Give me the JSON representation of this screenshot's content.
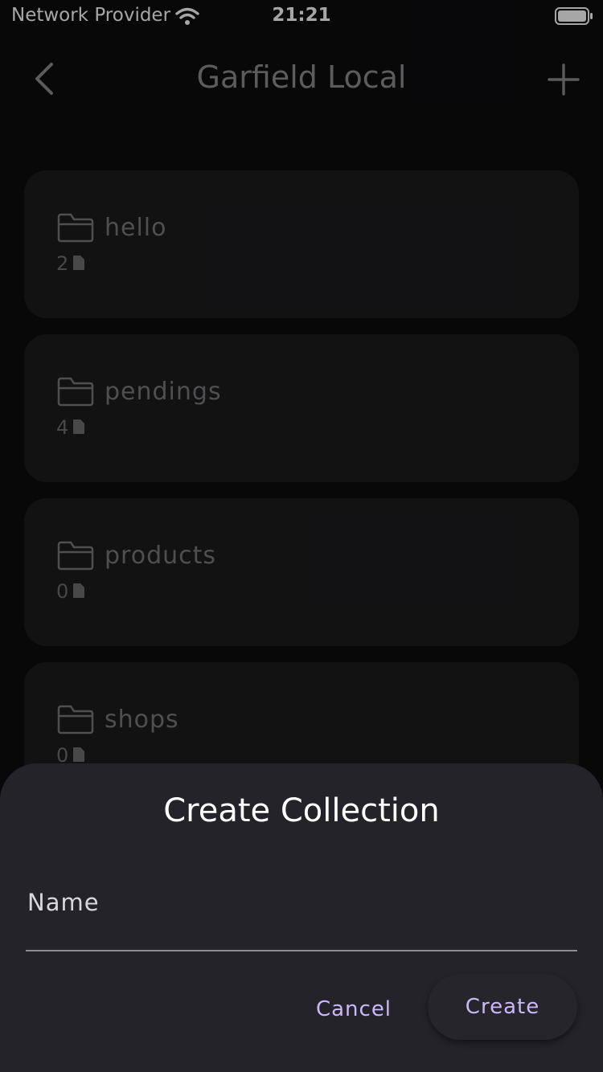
{
  "status_bar": {
    "carrier": "Network Provider",
    "time": "21:21",
    "wifi_icon": "wifi-icon",
    "battery_icon": "battery-icon"
  },
  "nav": {
    "title": "Garfield Local",
    "back_icon": "chevron-left-icon",
    "add_icon": "plus-icon"
  },
  "collections": [
    {
      "name": "hello",
      "count": "2"
    },
    {
      "name": "pendings",
      "count": "4"
    },
    {
      "name": "products",
      "count": "0"
    },
    {
      "name": "shops",
      "count": "0"
    }
  ],
  "dialog": {
    "title": "Create Collection",
    "field_label": "Name",
    "field_value": "",
    "cancel_label": "Cancel",
    "create_label": "Create"
  },
  "colors": {
    "background": "#0d0d0f",
    "card": "#1c1c1e",
    "sheet": "#24232a",
    "accent": "#cbb8f8"
  }
}
